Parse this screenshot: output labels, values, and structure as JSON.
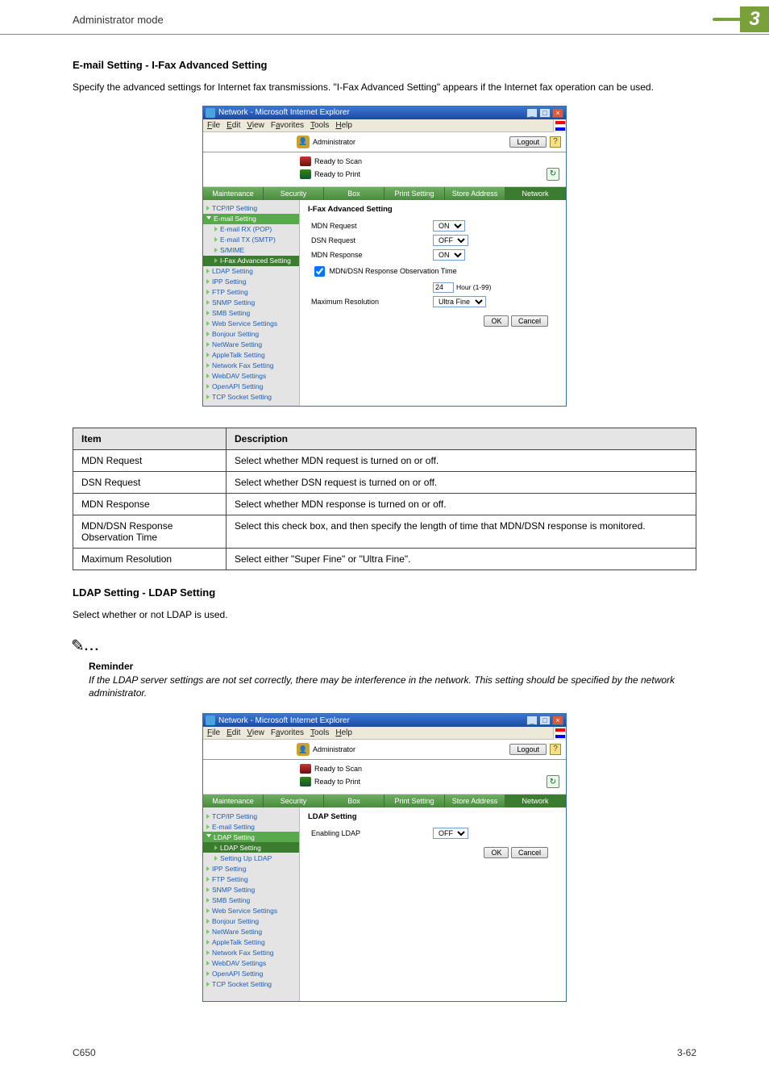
{
  "header": {
    "mode": "Administrator mode",
    "chapter": "3"
  },
  "section1": {
    "heading": "E-mail Setting - I-Fax Advanced Setting",
    "intro": "Specify the advanced settings for Internet fax transmissions. \"I-Fax Advanced Setting\" appears if the Internet fax operation can be used."
  },
  "ie_title": "Network - Microsoft Internet Explorer",
  "menu": {
    "file": "File",
    "edit": "Edit",
    "view": "View",
    "favorites": "Favorites",
    "tools": "Tools",
    "help": "Help"
  },
  "app": {
    "admin_label": "Administrator",
    "logout": "Logout",
    "status_scan": "Ready to Scan",
    "status_print": "Ready to Print",
    "tabs": {
      "maintenance": "Maintenance",
      "security": "Security",
      "box": "Box",
      "print": "Print Setting",
      "store": "Store Address",
      "network": "Network"
    },
    "sidebar1": [
      "TCP/IP Setting",
      "E-mail Setting",
      "E-mail RX (POP)",
      "E-mail TX (SMTP)",
      "S/MIME",
      "I-Fax Advanced Setting",
      "LDAP Setting",
      "IPP Setting",
      "FTP Setting",
      "SNMP Setting",
      "SMB Setting",
      "Web Service Settings",
      "Bonjour Setting",
      "NetWare Setting",
      "AppleTalk Setting",
      "Network Fax Setting",
      "WebDAV Settings",
      "OpenAPI Setting",
      "TCP Socket Setting"
    ],
    "form1": {
      "title": "I-Fax Advanced Setting",
      "mdn_request_label": "MDN Request",
      "mdn_request_val": "ON",
      "dsn_request_label": "DSN Request",
      "dsn_request_val": "OFF",
      "mdn_response_label": "MDN Response",
      "mdn_response_val": "ON",
      "obs_cb_label": "MDN/DSN Response Observation Time",
      "obs_val": "24",
      "obs_unit": "Hour (1-99)",
      "maxres_label": "Maximum Resolution",
      "maxres_val": "Ultra Fine",
      "ok": "OK",
      "cancel": "Cancel"
    }
  },
  "desc_table": {
    "h_item": "Item",
    "h_desc": "Description",
    "rows": [
      {
        "item": "MDN Request",
        "desc": "Select whether MDN request is turned on or off."
      },
      {
        "item": "DSN Request",
        "desc": "Select whether DSN request is turned on or off."
      },
      {
        "item": "MDN Response",
        "desc": "Select whether MDN response is turned on or off."
      },
      {
        "item": "MDN/DSN Response Observation Time",
        "desc": "Select this check box, and then specify the length of time that MDN/DSN response is monitored."
      },
      {
        "item": "Maximum Resolution",
        "desc": "Select either \"Super Fine\" or \"Ultra Fine\"."
      }
    ]
  },
  "section2": {
    "heading": "LDAP Setting - LDAP Setting",
    "intro": "Select whether or not LDAP is used.",
    "reminder_label": "Reminder",
    "reminder_text": "If the LDAP server settings are not set correctly, there may be interference in the network. This setting should be specified by the network administrator."
  },
  "app2": {
    "sidebar2": [
      "TCP/IP Setting",
      "E-mail Setting",
      "LDAP Setting",
      "LDAP Setting",
      "Setting Up LDAP",
      "IPP Setting",
      "FTP Setting",
      "SNMP Setting",
      "SMB Setting",
      "Web Service Settings",
      "Bonjour Setting",
      "NetWare Setting",
      "AppleTalk Setting",
      "Network Fax Setting",
      "WebDAV Settings",
      "OpenAPI Setting",
      "TCP Socket Setting"
    ],
    "form2": {
      "title": "LDAP Setting",
      "enabling_label": "Enabling LDAP",
      "enabling_val": "OFF",
      "ok": "OK",
      "cancel": "Cancel"
    }
  },
  "footer": {
    "model": "C650",
    "page": "3-62"
  }
}
